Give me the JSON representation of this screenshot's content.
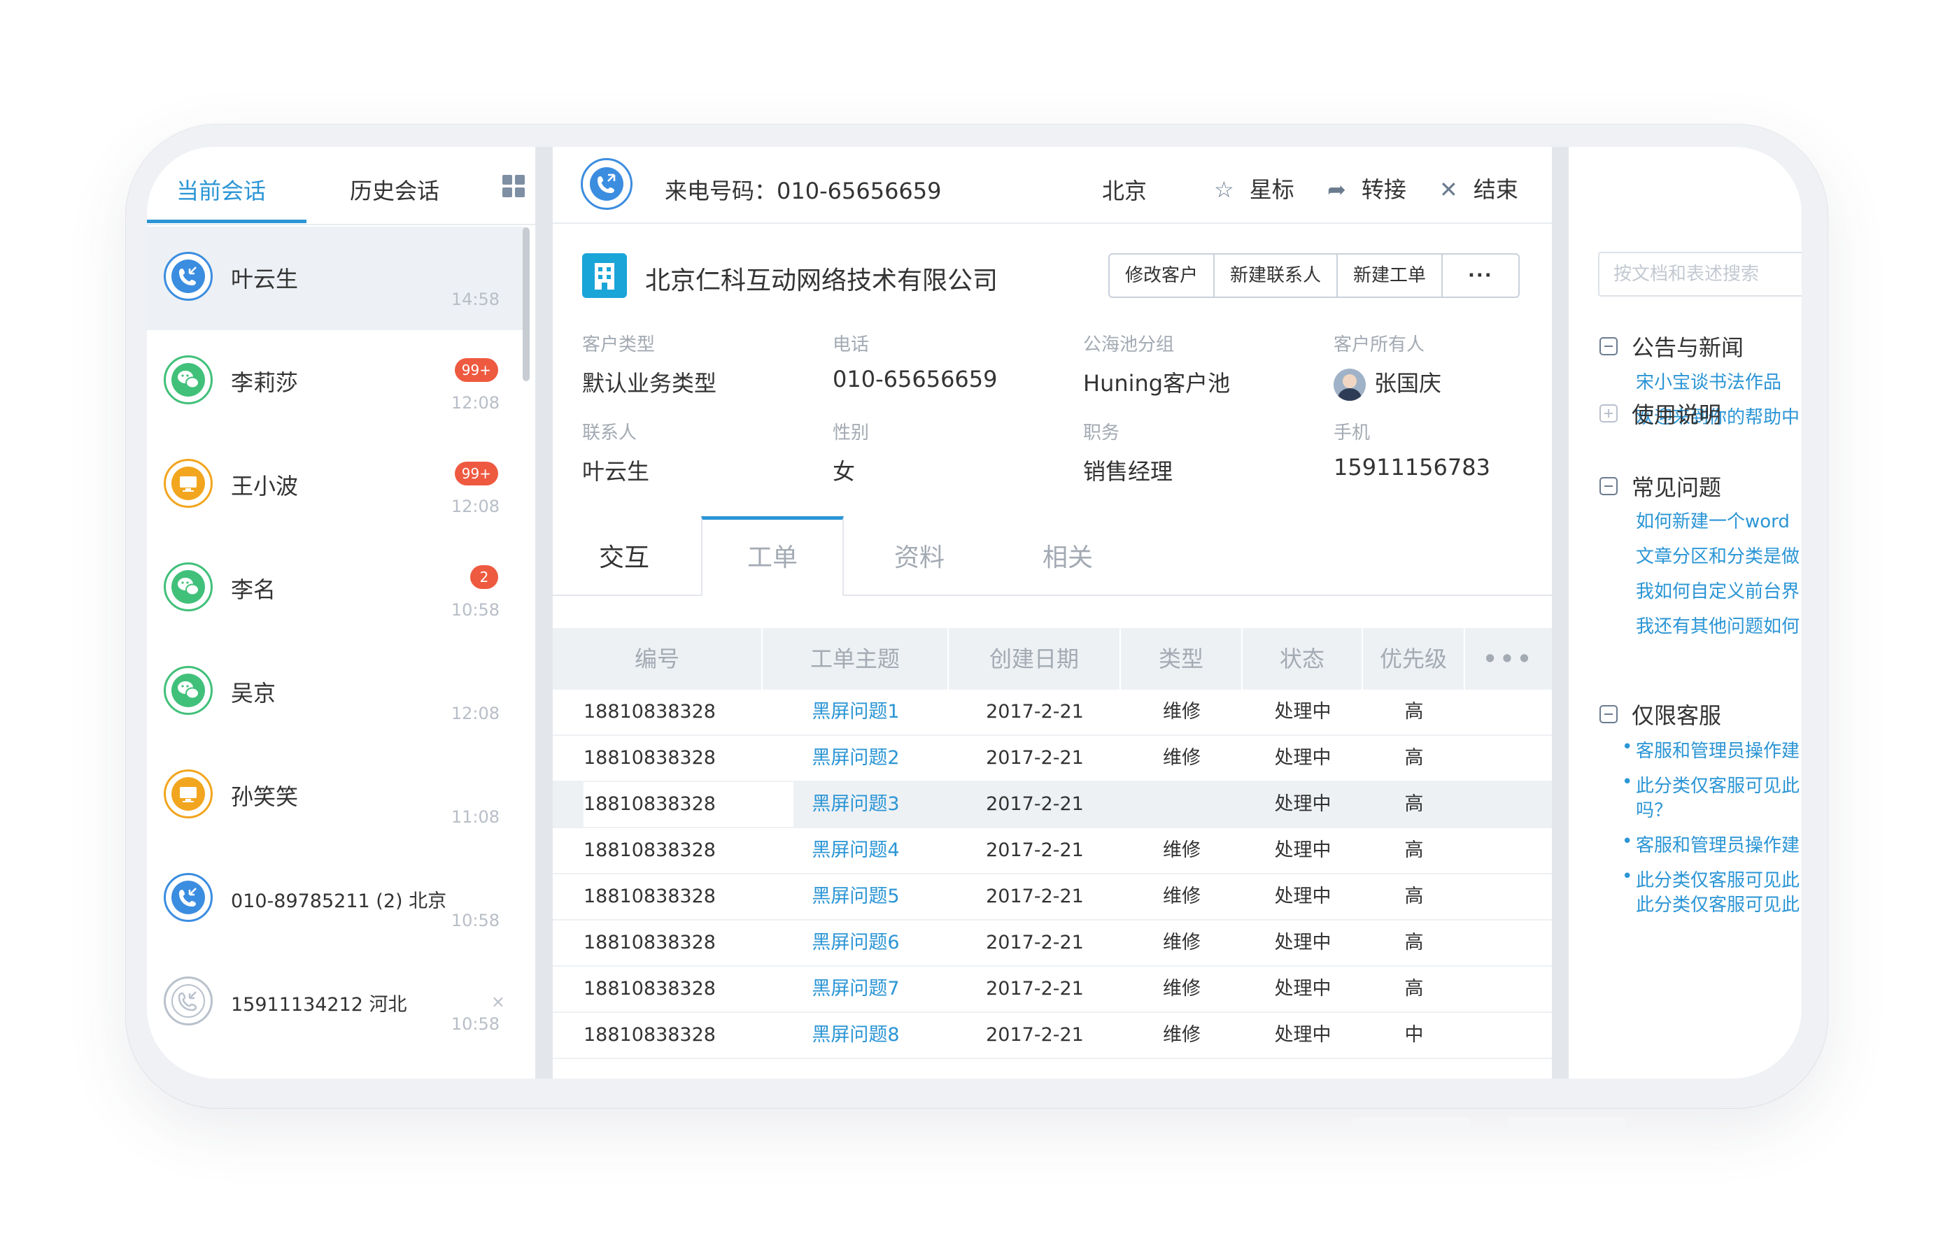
{
  "sessions_panel": {
    "tabs": [
      {
        "label": "当前会话"
      },
      {
        "label": "历史会话"
      }
    ],
    "sessions": [
      {
        "name": "叶云生",
        "time": "14:58",
        "badge": "",
        "channel": "phone",
        "selected": true
      },
      {
        "name": "李莉莎",
        "time": "12:08",
        "badge": "99+",
        "channel": "wechat"
      },
      {
        "name": "王小波",
        "time": "12:08",
        "badge": "99+",
        "channel": "web"
      },
      {
        "name": "李名",
        "time": "10:58",
        "badge": "2",
        "channel": "wechat"
      },
      {
        "name": "吴京",
        "time": "12:08",
        "badge": "",
        "channel": "wechat"
      },
      {
        "name": "孙笑笑",
        "time": "11:08",
        "badge": "",
        "channel": "web"
      },
      {
        "name": "010-89785211 (2) 北京",
        "time": "10:58",
        "badge": "",
        "channel": "phone"
      },
      {
        "name": "15911134212  河北",
        "time": "10:58",
        "badge": "",
        "channel": "missed",
        "close": "×"
      }
    ]
  },
  "call_bar": {
    "label": "来电号码：010-65656659",
    "city": "北京",
    "actions": [
      {
        "icon": "star-icon",
        "glyph": "☆",
        "label": "星标"
      },
      {
        "icon": "forward-icon",
        "glyph": "➦",
        "label": "转接"
      },
      {
        "icon": "close-icon",
        "glyph": "✕",
        "label": "结束"
      }
    ]
  },
  "customer": {
    "company": "北京仁科互动网络技术有限公司",
    "buttons": [
      "修改客户",
      "新建联系人",
      "新建工单",
      "···"
    ],
    "fields": [
      {
        "label": "客户类型",
        "value": "默认业务类型"
      },
      {
        "label": "电话",
        "value": "010-65656659"
      },
      {
        "label": "公海池分组",
        "value": "Huning客户池"
      },
      {
        "label": "客户所有人",
        "value": "张国庆"
      },
      {
        "label": "联系人",
        "value": "叶云生"
      },
      {
        "label": "性别",
        "value": "女"
      },
      {
        "label": "职务",
        "value": "销售经理"
      },
      {
        "label": "手机",
        "value": "15911156783"
      }
    ]
  },
  "detail_tabs": [
    "交互",
    "工单",
    "资料",
    "相关"
  ],
  "tickets": {
    "columns": [
      "编号",
      "工单主题",
      "创建日期",
      "类型",
      "状态",
      "优先级",
      "•••"
    ],
    "rows": [
      [
        "18810838328",
        "黑屏问题1",
        "2017-2-21",
        "维修",
        "处理中",
        "高"
      ],
      [
        "18810838328",
        "黑屏问题2",
        "2017-2-21",
        "维修",
        "处理中",
        "高"
      ],
      [
        "18810838328",
        "黑屏问题3",
        "2017-2-21",
        "",
        "处理中",
        "高"
      ],
      [
        "18810838328",
        "黑屏问题4",
        "2017-2-21",
        "维修",
        "处理中",
        "高"
      ],
      [
        "18810838328",
        "黑屏问题5",
        "2017-2-21",
        "维修",
        "处理中",
        "高"
      ],
      [
        "18810838328",
        "黑屏问题6",
        "2017-2-21",
        "维修",
        "处理中",
        "高"
      ],
      [
        "18810838328",
        "黑屏问题7",
        "2017-2-21",
        "维修",
        "处理中",
        "高"
      ],
      [
        "18810838328",
        "黑屏问题8",
        "2017-2-21",
        "维修",
        "处理中",
        "中"
      ]
    ]
  },
  "knowledge_base": {
    "search_placeholder": "按文档和表述搜索",
    "sections": [
      {
        "title": "公告与新闻",
        "expanded": true,
        "links": [
          "宋小宝谈书法作品",
          "欢迎来到你的帮助中"
        ]
      },
      {
        "title": "使用说明",
        "expanded": false,
        "links": []
      },
      {
        "title": "常见问题",
        "expanded": true,
        "links": [
          "如何新建一个word",
          "文章分区和分类是做",
          "我如何自定义前台界",
          "我还有其他问题如何"
        ]
      },
      {
        "title": "仅限客服",
        "expanded": true,
        "links": [
          "客服和管理员操作建",
          "此分类仅客服可见此",
          "吗？",
          "客服和管理员操作建",
          "此分类仅客服可见此",
          "此分类仅客服可见此"
        ]
      }
    ]
  },
  "colors": {
    "accent": "#2b95d5",
    "phone": "#3b8de0",
    "wechat": "#41c07a",
    "web": "#f2a51e",
    "badge": "#ee5a40"
  }
}
